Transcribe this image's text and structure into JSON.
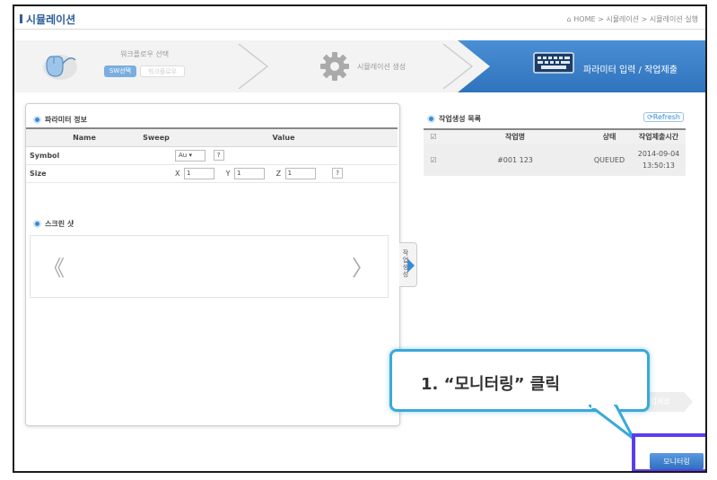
{
  "header": {
    "title": "시뮬레이션",
    "breadcrumb": "⌂ HOME > 시뮬레이션 > 시뮬레이션 실행"
  },
  "steps": {
    "step1_title": "워크플로우 선택",
    "step1_active_tab": "SW선택",
    "step1_inactive_tab": "워크플로우",
    "step2_title": "시뮬레이션 생성",
    "step3_title": "파라미터 입력 / 작업제출"
  },
  "param_panel": {
    "title": "파라미터 정보",
    "headers": [
      "Name",
      "Sweep",
      "Value"
    ],
    "symbol_label": "Symbol",
    "symbol_value": "Au",
    "help_label": "?",
    "size_label": "Size",
    "x_label": "X",
    "x_value": "1",
    "y_label": "Y",
    "y_value": "1",
    "z_label": "Z",
    "z_value": "1"
  },
  "screenshot_panel": {
    "title": "스크린 샷",
    "prev": "《",
    "next": "〉"
  },
  "side_tab": {
    "label": "작업생성"
  },
  "job_panel": {
    "title": "작업생성 목록",
    "refresh": "Refresh",
    "headers": [
      "작업명",
      "상태",
      "작업제출시간"
    ],
    "rows": [
      {
        "name": "#001 123",
        "status": "QUEUED",
        "date": "2014-09-04",
        "time": "13:50:13"
      }
    ]
  },
  "submit_arrow": "작업제출",
  "callout": {
    "text": "1. “모니터링” 클릭"
  },
  "monitor_button": "모니터링",
  "colors": {
    "accent": "#2f73bd",
    "highlight": "#5b3df0",
    "callout_border": "#39a9d8"
  }
}
